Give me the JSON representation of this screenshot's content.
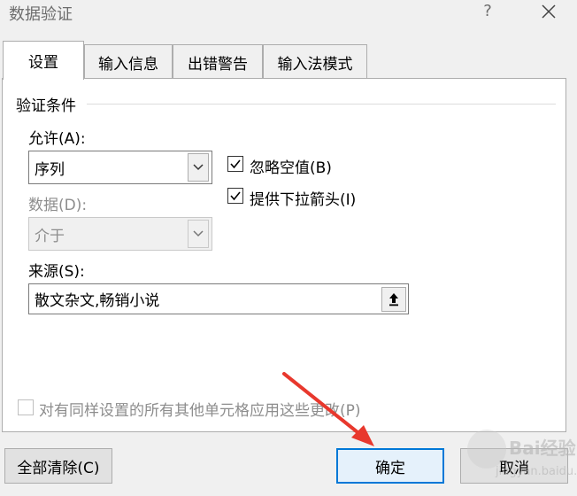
{
  "window": {
    "title": "数据验证",
    "help": "?"
  },
  "tabs": [
    {
      "label": "设置",
      "active": true
    },
    {
      "label": "输入信息",
      "active": false
    },
    {
      "label": "出错警告",
      "active": false
    },
    {
      "label": "输入法模式",
      "active": false
    }
  ],
  "group": {
    "title": "验证条件"
  },
  "allow": {
    "label": "允许(A):",
    "value": "序列"
  },
  "data_field": {
    "label": "数据(D):",
    "value": "介于"
  },
  "checkboxes": {
    "ignore_blank": {
      "label": "忽略空值(B)",
      "checked": true
    },
    "dropdown": {
      "label": "提供下拉箭头(I)",
      "checked": true
    },
    "apply_all": {
      "label": "对有同样设置的所有其他单元格应用这些更改(P)",
      "checked": false
    }
  },
  "source": {
    "label": "来源(S):",
    "value": "散文杂文,畅销小说"
  },
  "buttons": {
    "clear_all": "全部清除(C)",
    "ok": "确定",
    "cancel": "取消"
  },
  "watermark": {
    "text": "Bai经验",
    "sub": "jingyan.baidu.com"
  },
  "colors": {
    "accent": "#0078d7",
    "arrow": "#e8382d"
  }
}
